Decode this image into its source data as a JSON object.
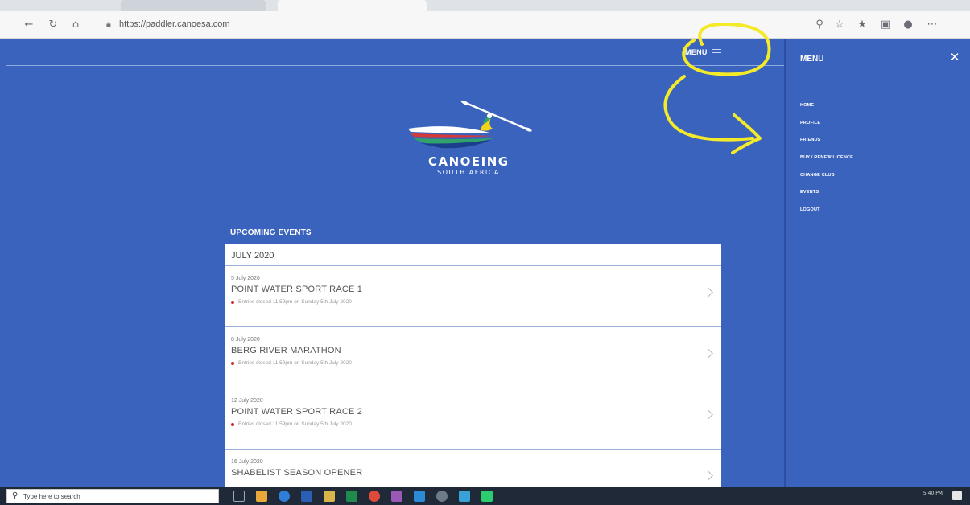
{
  "browser": {
    "url": "https://paddler.canoesa.com"
  },
  "header": {
    "menu_label": "MENU"
  },
  "logo": {
    "title": "CANOEING",
    "subtitle": "SOUTH AFRICA"
  },
  "events": {
    "heading": "UPCOMING EVENTS",
    "month": "JULY 2020",
    "items": [
      {
        "date": "5 July 2020",
        "title": "POINT WATER SPORT RACE 1",
        "status": "Entries closed 11:59pm on Sunday 5th July 2020"
      },
      {
        "date": "8 July 2020",
        "title": "BERG RIVER MARATHON",
        "status": "Entries closed 11:59pm on Sunday 5th July 2020"
      },
      {
        "date": "12 July 2020",
        "title": "POINT WATER SPORT RACE 2",
        "status": "Entries closed 11:59pm on Sunday 5th July 2020"
      },
      {
        "date": "16 July 2020",
        "title": "SHABELIST SEASON OPENER",
        "status": ""
      }
    ]
  },
  "side_menu": {
    "title": "MENU",
    "items": [
      "HOME",
      "PROFILE",
      "FRIENDS",
      "BUY / RENEW LICENCE",
      "CHANGE CLUB",
      "EVENTS",
      "LOGOUT"
    ]
  },
  "taskbar": {
    "search_placeholder": "Type here to search",
    "time": "5:40 PM"
  },
  "colors": {
    "page_bg": "#3a63bd",
    "annotation": "#f4ea2a",
    "status_dot": "#d81f2a"
  },
  "icons": [
    "back-icon",
    "refresh-icon",
    "home-icon",
    "lock-icon",
    "hamburger-icon",
    "close-icon",
    "chevron-right-icon",
    "search-icon"
  ]
}
